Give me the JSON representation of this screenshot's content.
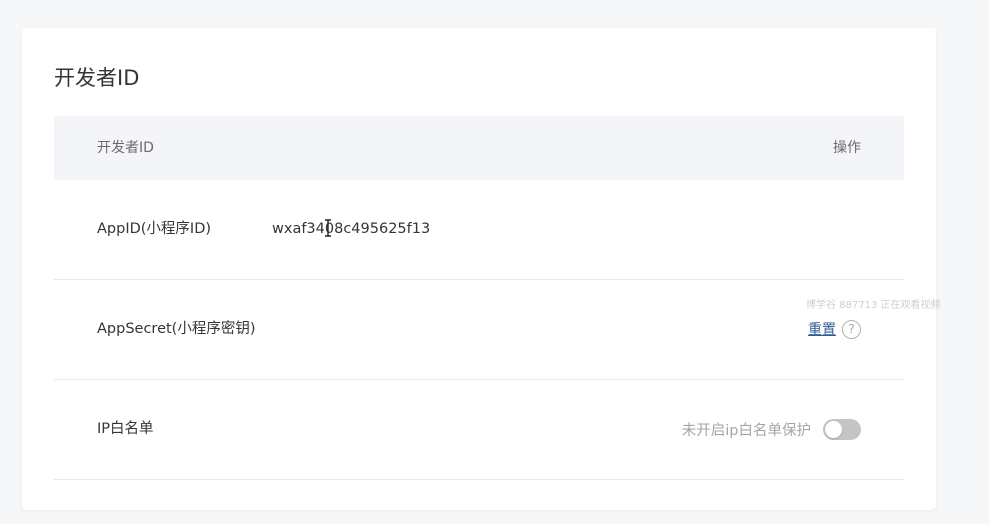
{
  "card": {
    "title": "开发者ID"
  },
  "table": {
    "headers": {
      "left": "开发者ID",
      "right": "操作"
    },
    "rows": [
      {
        "label": "AppID(小程序ID)",
        "value": "wxaf3408c495625f13"
      },
      {
        "label": "AppSecret(小程序密钥)",
        "action_label": "重置",
        "help_icon": "?"
      },
      {
        "label": "IP白名单",
        "status": "未开启ip白名单保护",
        "toggle_on": false
      }
    ]
  },
  "overlay": {
    "watermark": "博学谷 887713 正在观看视频"
  },
  "colors": {
    "link": "#2f5d93",
    "header_bg": "#f4f5f9",
    "toggle_off": "#c4c4c4"
  }
}
